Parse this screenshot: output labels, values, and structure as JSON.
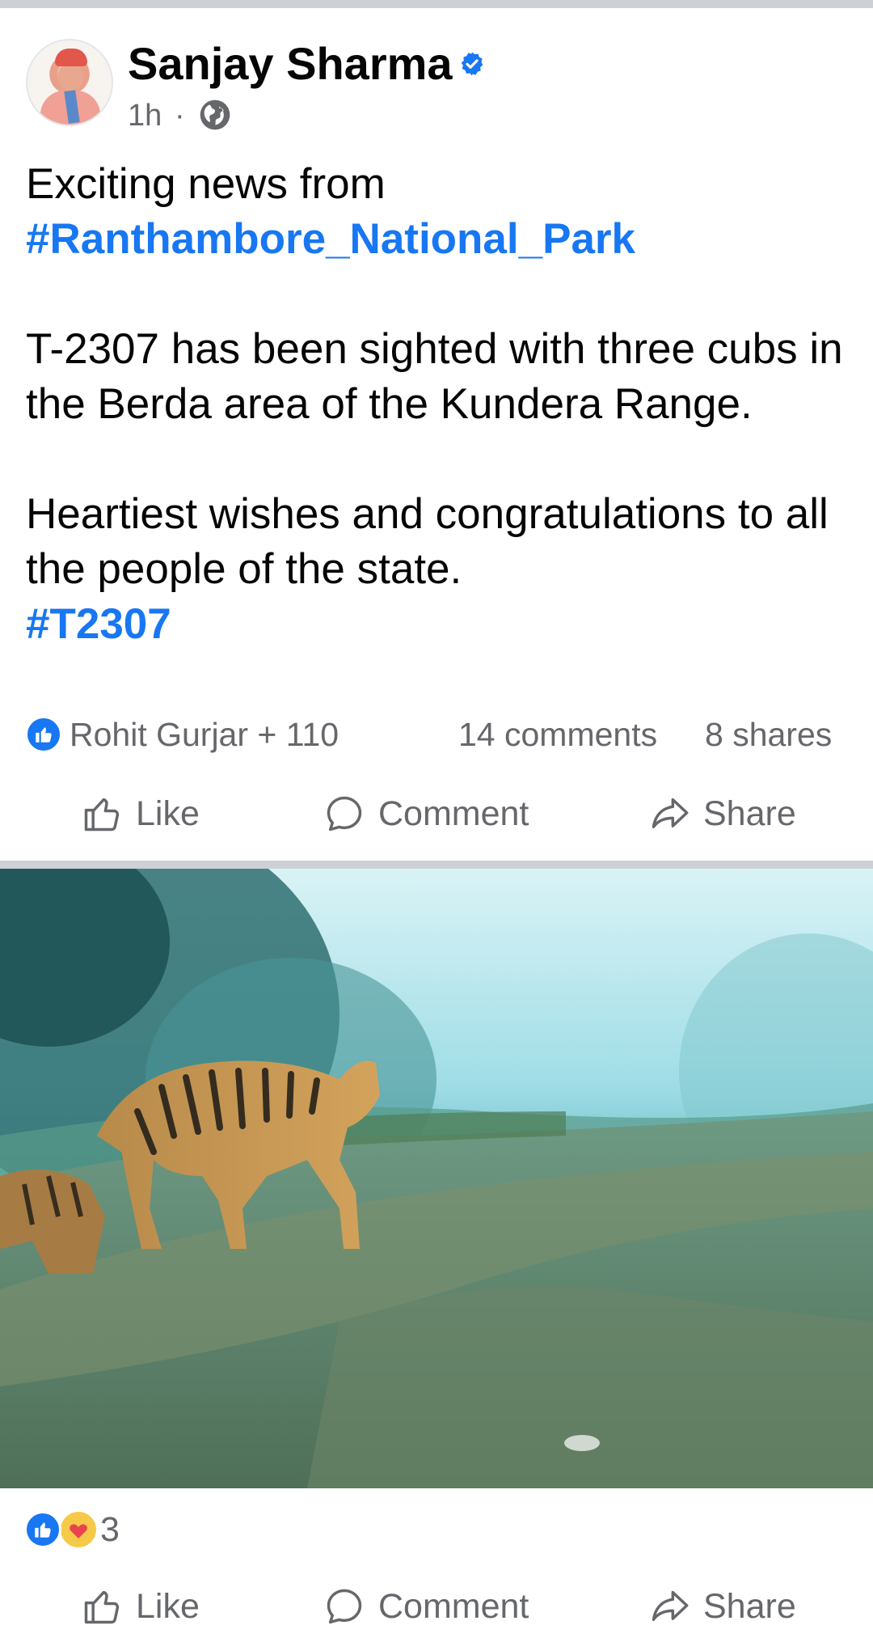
{
  "post": {
    "author": "Sanjay Sharma",
    "time": "1h",
    "separator": "·",
    "visibility_icon": "globe-icon",
    "verified_icon": "verified-badge-icon",
    "text": {
      "line1": "Exciting news from",
      "hashtag1": "#Ranthambore_National_Park",
      "para2": "T-2307 has been sighted with three cubs in the Berda area of the Kundera Range.",
      "para3": "Heartiest wishes and congratulations to all the people of the state.",
      "hashtag2": "#T2307"
    },
    "stats": {
      "reactors": "Rohit Gurjar + 110",
      "comments": "14 comments",
      "shares": "8 shares"
    },
    "actions": {
      "like": "Like",
      "comment": "Comment",
      "share": "Share"
    }
  },
  "photo_post": {
    "image_alt": "Tiger and cub walking on a misty forest trail",
    "reaction_count": "3",
    "actions": {
      "like": "Like",
      "comment": "Comment",
      "share": "Share"
    }
  },
  "colors": {
    "link": "#1877f2",
    "secondary_text": "#65676b",
    "divider": "#cdd0d4"
  }
}
